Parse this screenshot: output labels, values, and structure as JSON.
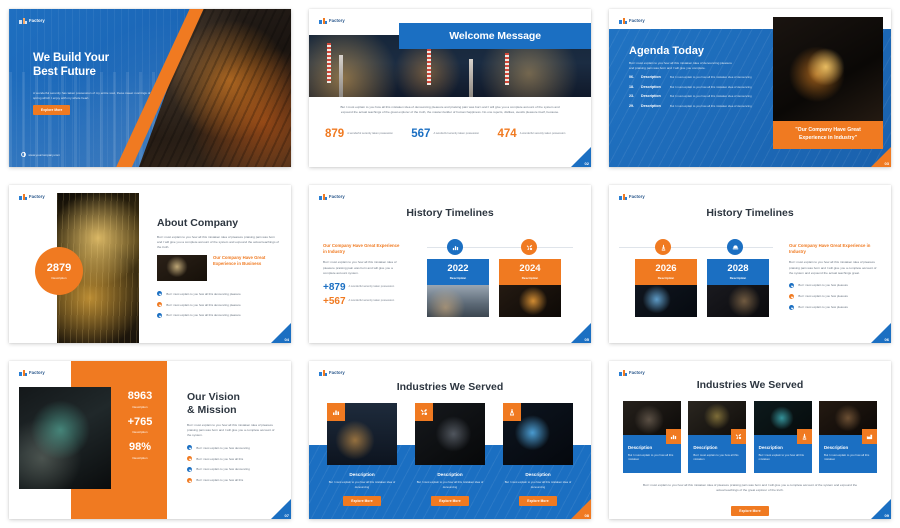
{
  "brand": {
    "logo_text": "Factory",
    "accent_orange": "#f07a21",
    "accent_blue": "#1b6fc2",
    "dark_text": "#2d3640"
  },
  "slides": [
    {
      "id": "hero",
      "page_number": "01",
      "title_line1": "We Build Your",
      "title_line2": "Best Future",
      "description": "A wonderful serenity has taken possession of my entire soul, these sweet mornings of spring which I enjoy with my whole heart.",
      "button_label": "Explore More",
      "website": "www.yourcompany.com"
    },
    {
      "id": "welcome",
      "page_number": "02",
      "title": "Welcome Message",
      "paragraph": "But I must explain to you how all this mistaken idea of denouncing pleasure and praising pain was born and I will give you a complete account of the system and expound the actual teachings of the great explorer of the truth, the master-builder of human happiness. No one rejects, dislikes, avoids pleasure itself, because.",
      "stats": [
        {
          "value": "879",
          "color": "orange",
          "label": "A wonderful serenity taken possession"
        },
        {
          "value": "567",
          "color": "blue",
          "label": "A wonderful serenity taken possession"
        },
        {
          "value": "474",
          "color": "orange",
          "label": "A wonderful serenity taken possession"
        }
      ]
    },
    {
      "id": "agenda",
      "page_number": "03",
      "title": "Agenda Today",
      "subtitle": "But I must explain to you how all this mistaken idea of denouncing pleasure and praising pain was born and I will give you complete.",
      "items": [
        {
          "number": "06.",
          "label": "Description",
          "text": "But I must explain to you how all this mistaken idea of denouncing"
        },
        {
          "number": "18.",
          "label": "Description",
          "text": "But I must explain to you how all this mistaken idea of denouncing"
        },
        {
          "number": "23.",
          "label": "Description",
          "text": "But I must explain to you how all this mistaken idea of denouncing"
        },
        {
          "number": "29.",
          "label": "Description",
          "text": "But I must explain to you how all this mistaken idea of denouncing"
        }
      ],
      "quote": "\"Our Company Have Great Experience in Industry\""
    },
    {
      "id": "about",
      "page_number": "04",
      "badge_value": "2879",
      "badge_label": "Description",
      "title": "About Company",
      "description": "But I must explain to you how all this mistaken idea of pleasure praising pain was born and I will give you a complete account of the system and expound the actual teachings of the truth.",
      "highlight": "Our Company Have Great Experience in Business",
      "bullets": [
        "But I must explain to you how all this denouncing pleasure",
        "But I must explain to you how all this denouncing pleasure",
        "But I must explain to you how all this denouncing pleasure"
      ]
    },
    {
      "id": "history-1",
      "page_number": "05",
      "title": "History Timelines",
      "side_highlight": "Our Company Have Great Experience in Industry",
      "side_description": "But I must explain to you how all this mistaken idea of pleasure praising pain was born and will give you a complete account system.",
      "side_stats": [
        {
          "value": "+879",
          "color": "blue",
          "label": "A wonderful serenity taken possession"
        },
        {
          "value": "+567",
          "color": "orange",
          "label": "A wonderful serenity taken possession"
        }
      ],
      "cards": [
        {
          "year": "2022",
          "label": "Description",
          "color": "blue",
          "icon": "bar-chart-icon"
        },
        {
          "year": "2024",
          "label": "Description",
          "color": "orange",
          "icon": "tools-icon"
        }
      ]
    },
    {
      "id": "history-2",
      "page_number": "06",
      "title": "History Timelines",
      "side_highlight": "Our Company Have Great Experience in Industry",
      "side_description": "But I must explain to you how all this mistaken idea of pleasure praising pain was born and I will give you a complete account of the system and expound the actual teachings great.",
      "bullets": [
        "But I must explain to you how pleasure",
        "But I must explain to you how pleasure",
        "But I must explain to you how pleasure"
      ],
      "cards": [
        {
          "year": "2026",
          "label": "Description",
          "color": "orange",
          "icon": "oil-rig-icon"
        },
        {
          "year": "2028",
          "label": "Description",
          "color": "blue",
          "icon": "helmet-icon"
        }
      ]
    },
    {
      "id": "vision",
      "page_number": "07",
      "title_line1": "Our Vision",
      "title_line2": "& Mission",
      "description": "But I must explain to you how all this mistaken idea of pleasure praising pain was born and I will give you a complete account of the system.",
      "stats": [
        {
          "value": "8963",
          "label": "Description"
        },
        {
          "value": "+765",
          "label": "Description"
        },
        {
          "value": "98%",
          "label": "Description"
        }
      ],
      "bullets": [
        "But I must explain to you how denouncing",
        "But I must explain to you how all this",
        "But I must explain to you how denouncing",
        "But I must explain to you how all this"
      ]
    },
    {
      "id": "industries-3",
      "page_number": "08",
      "title": "Industries We Served",
      "cards": [
        {
          "heading": "Description",
          "text": "But I must explain to you how all this mistaken idea of denouncing",
          "button": "Explore More",
          "icon": "bar-chart-icon"
        },
        {
          "heading": "Description",
          "text": "But I must explain to you how all this mistaken idea of denouncing",
          "button": "Explore More",
          "icon": "tools-icon"
        },
        {
          "heading": "Description",
          "text": "But I must explain to you how all this mistaken idea of denouncing",
          "button": "Explore More",
          "icon": "oil-rig-icon"
        }
      ]
    },
    {
      "id": "industries-4",
      "page_number": "09",
      "title": "Industries We Served",
      "cards": [
        {
          "heading": "Description",
          "text": "But I must explain to you how all this mistaken",
          "icon": "bar-chart-icon"
        },
        {
          "heading": "Description",
          "text": "But I must explain to you how all this mistaken",
          "icon": "tools-icon"
        },
        {
          "heading": "Description",
          "text": "But I must explain to you how all this mistaken",
          "icon": "oil-rig-icon"
        },
        {
          "heading": "Description",
          "text": "But I must explain to you how all this mistaken",
          "icon": "factory-icon"
        }
      ],
      "footer": "But I must explain to you how all this mistaken idea of pleasure praising pain was born and I will give you a complete account of the system and expound the actual teachings of the great explorer of the truth.",
      "button_label": "Explore More"
    }
  ]
}
